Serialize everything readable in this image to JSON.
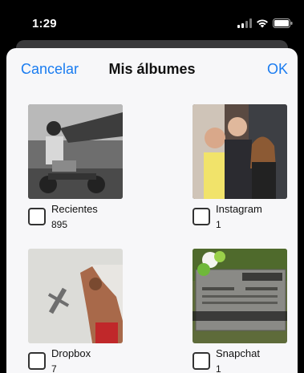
{
  "status_bar": {
    "time": "1:29",
    "icons": [
      "signal-icon",
      "wifi-icon",
      "battery-icon"
    ]
  },
  "nav": {
    "cancel_label": "Cancelar",
    "title": "Mis álbumes",
    "ok_label": "OK",
    "accent_color": "#1a7cf0"
  },
  "albums": [
    {
      "name": "Recientes",
      "count": "895",
      "checked": false
    },
    {
      "name": "Instagram",
      "count": "1",
      "checked": false
    },
    {
      "name": "Dropbox",
      "count": "7",
      "checked": false
    },
    {
      "name": "Snapchat",
      "count": "1",
      "checked": false
    }
  ]
}
